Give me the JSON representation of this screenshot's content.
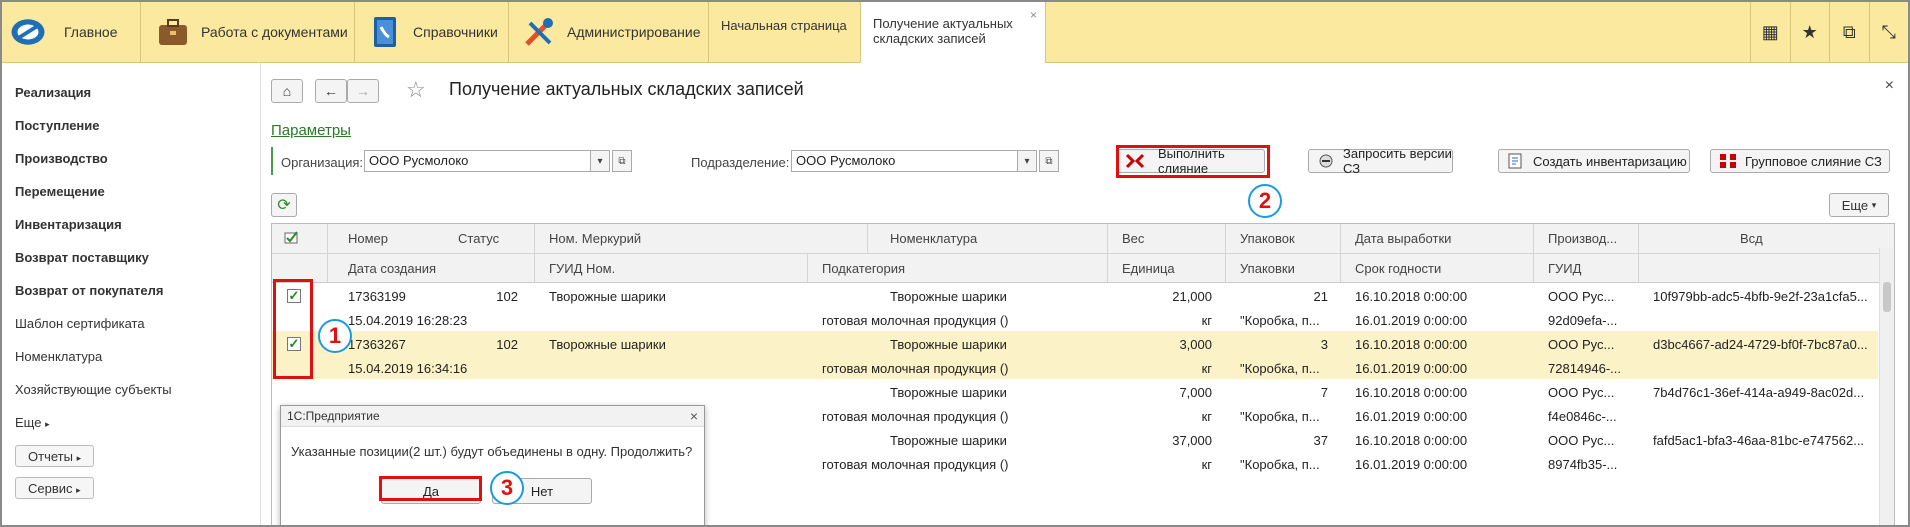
{
  "topbar": {
    "home_label": "Главное",
    "sections": [
      {
        "label": "Работа с документами",
        "icon": "briefcase-icon"
      },
      {
        "label": "Справочники",
        "icon": "phonebook-icon"
      },
      {
        "label": "Администрирование",
        "icon": "tools-icon"
      }
    ],
    "tabs": [
      {
        "label": "Начальная страница"
      },
      {
        "label_line1": "Получение актуальных",
        "label_line2": "складских записей",
        "close": "×"
      }
    ],
    "right_icons": [
      "apps-grid-icon",
      "star-icon",
      "history-icon",
      "menu-arrow-icon"
    ]
  },
  "sidebar": {
    "items": [
      {
        "label": "Реализация",
        "bold": true
      },
      {
        "label": "Поступление",
        "bold": true
      },
      {
        "label": "Производство",
        "bold": true
      },
      {
        "label": "Перемещение",
        "bold": true
      },
      {
        "label": "Инвентаризация",
        "bold": true
      },
      {
        "label": "Возврат поставщику",
        "bold": true
      },
      {
        "label": "Возврат от покупателя",
        "bold": true
      },
      {
        "label": "Шаблон сертификата",
        "bold": false
      },
      {
        "label": "Номенклатура",
        "bold": false
      },
      {
        "label": "Хозяйствующие субъекты",
        "bold": false
      },
      {
        "label": "Еще",
        "bold": false
      }
    ],
    "buttons": [
      {
        "label": "Отчеты"
      },
      {
        "label": "Сервис"
      }
    ]
  },
  "form": {
    "title": "Получение актуальных складских записей",
    "params_link": "Параметры",
    "org_label": "Организация:",
    "org_value": "ООО Русмолоко",
    "dept_label": "Подразделение:",
    "dept_value": "ООО Русмолоко",
    "buttons": {
      "merge": "Выполнить слияние",
      "request": "Запросить версии СЗ",
      "inventory": "Создать инвентаризацию",
      "group_merge": "Групповое слияние СЗ",
      "more": "Еще"
    }
  },
  "table": {
    "header_row1": [
      "Номер",
      "Статус",
      "Ном. Меркурий",
      "Номенклатура",
      "Вес",
      "Упаковок",
      "Дата выработки",
      "Производ...",
      "Всд"
    ],
    "header_row2": [
      "Дата создания",
      "ГУИД Ном.",
      "Подкатегория",
      "Единица",
      "Упаковки",
      "Срок годности",
      "ГУИД"
    ],
    "rows": [
      {
        "checked": true,
        "selected": false,
        "number": "17363199",
        "status": "102",
        "merc": "Творожные шарики",
        "nom": "Творожные шарики",
        "weight": "21,000",
        "packs": "21",
        "made": "16.10.2018 0:00:00",
        "producer": "ООО Рус...",
        "vsd": "10f979bb-adc5-4bfb-9e2f-23a1cfa5...",
        "created": "15.04.2019 16:28:23",
        "guid_nom": "",
        "subcat": "готовая молочная продукция ()",
        "unit": "кг",
        "pack_type": "\"Коробка, п...",
        "expires": "16.01.2019 0:00:00",
        "guid": "92d09efa-..."
      },
      {
        "checked": true,
        "selected": true,
        "number": "17363267",
        "status": "102",
        "merc": "Творожные шарики",
        "nom": "Творожные шарики",
        "weight": "3,000",
        "packs": "3",
        "made": "16.10.2018 0:00:00",
        "producer": "ООО Рус...",
        "vsd": "d3bc4667-ad24-4729-bf0f-7bc87a0...",
        "created": "15.04.2019 16:34:16",
        "guid_nom": "",
        "subcat": "готовая молочная продукция ()",
        "unit": "кг",
        "pack_type": "\"Коробка, п...",
        "expires": "16.01.2019 0:00:00",
        "guid": "72814946-..."
      },
      {
        "checked": false,
        "selected": false,
        "number": "",
        "status": "",
        "merc": "",
        "nom": "Творожные шарики",
        "weight": "7,000",
        "packs": "7",
        "made": "16.10.2018 0:00:00",
        "producer": "ООО Рус...",
        "vsd": "7b4d76c1-36ef-414a-a949-8ac02d...",
        "created": "",
        "guid_nom": "",
        "subcat": "готовая молочная продукция ()",
        "unit": "кг",
        "pack_type": "\"Коробка, п...",
        "expires": "16.01.2019 0:00:00",
        "guid": "f4e0846c-..."
      },
      {
        "checked": false,
        "selected": false,
        "number": "",
        "status": "",
        "merc": "",
        "nom": "Творожные шарики",
        "weight": "37,000",
        "packs": "37",
        "made": "16.10.2018 0:00:00",
        "producer": "ООО Рус...",
        "vsd": "fafd5ac1-bfa3-46aa-81bc-e747562...",
        "created": "",
        "guid_nom": "",
        "subcat": "готовая молочная продукция ()",
        "unit": "кг",
        "pack_type": "\"Коробка, п...",
        "expires": "16.01.2019 0:00:00",
        "guid": "8974fb35-..."
      }
    ]
  },
  "dialog": {
    "title": "1С:Предприятие",
    "close": "×",
    "message": "Указанные позиции(2 шт.) будут объединены в одну. Продолжить?",
    "yes": "Да",
    "no": "Нет"
  },
  "annotations": {
    "one": "1",
    "two": "2",
    "three": "3"
  },
  "colors": {
    "topbar": "#fbe9a0",
    "highlight_row": "#fbf2c8",
    "annotation_red": "#e01010",
    "annotation_blue": "#1a9be0",
    "link_green": "#2a7a2a"
  }
}
